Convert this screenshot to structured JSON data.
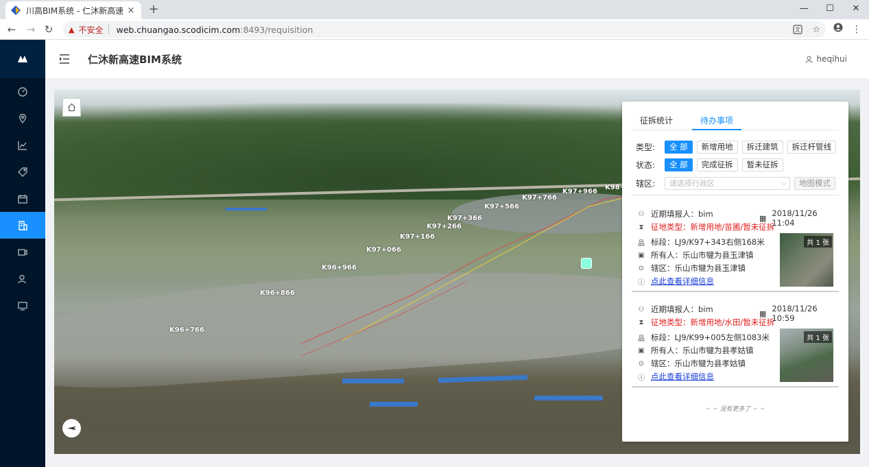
{
  "browser": {
    "tab_title": "川高BIM系统 - 仁沐新高速",
    "tab_close": "×",
    "new_tab": "+",
    "insecure_label": "不安全",
    "url_host": "web.chuangao.scodicim.com",
    "url_path": ":8493/requisition",
    "minimize": "—",
    "maximize": "☐",
    "close": "✕",
    "back": "←",
    "forward": "→",
    "reload": "↻",
    "star": "☆",
    "menu": "⋮"
  },
  "header": {
    "title": "仁沐新高速BIM系统",
    "username": "heqihui"
  },
  "sidebar": {
    "items": [
      {
        "icon": "dashboard-icon",
        "active": false
      },
      {
        "icon": "location-pin-icon",
        "active": false
      },
      {
        "icon": "line-chart-icon",
        "active": false
      },
      {
        "icon": "tag-icon",
        "active": false
      },
      {
        "icon": "calendar-icon",
        "active": false
      },
      {
        "icon": "requisition-icon",
        "active": true
      },
      {
        "icon": "video-icon",
        "active": false
      },
      {
        "icon": "users-icon",
        "active": false
      },
      {
        "icon": "monitor-icon",
        "active": false
      }
    ]
  },
  "map": {
    "stakes": [
      "K98+",
      "K97+966",
      "K97+766",
      "K97+566",
      "K97+366",
      "K97+266",
      "K97+166",
      "K97+066",
      "K96+966",
      "K96+866",
      "K96+766"
    ]
  },
  "panel": {
    "tabs": [
      {
        "label": "征拆统计",
        "active": false
      },
      {
        "label": "待办事项",
        "active": true
      }
    ],
    "type_label": "类型:",
    "type_options": [
      "全 部",
      "新增用地",
      "拆迁建筑",
      "拆迁杆管线"
    ],
    "status_label": "状态:",
    "status_options": [
      "全 部",
      "完成征拆",
      "暂未征拆"
    ],
    "district_label": "辖区:",
    "district_placeholder": "请选择行政区",
    "map_mode_button": "地图模式",
    "records": [
      {
        "reporter": "近期填报人：bim",
        "date": "2018/11/26 11:04",
        "category": "征地类型：新增用地/苗圃/暂未征拆",
        "section": "标段：LJ9/K97+343右侧168米",
        "owner": "所有人：乐山市犍为县玉津镇",
        "district": "辖区：乐山市犍为县玉津镇",
        "detail_link": "点此查看详细信息",
        "photo_count": "共 1 张"
      },
      {
        "reporter": "近期填报人：bim",
        "date": "2018/11/26 10:59",
        "category": "征地类型：新增用地/水田/暂未征拆",
        "section": "标段：LJ9/K99+005左侧1083米",
        "owner": "所有人：乐山市犍为县孝姑镇",
        "district": "辖区：乐山市犍为县孝姑镇",
        "detail_link": "点此查看详细信息",
        "photo_count": "共 1 张"
      }
    ],
    "no_more": "~ ~ 没有更多了 ~ ~"
  },
  "colors": {
    "accent": "#1890ff",
    "sidebar_bg": "#001529",
    "warning_red": "#e02020",
    "link_blue": "#1a3fd6"
  }
}
